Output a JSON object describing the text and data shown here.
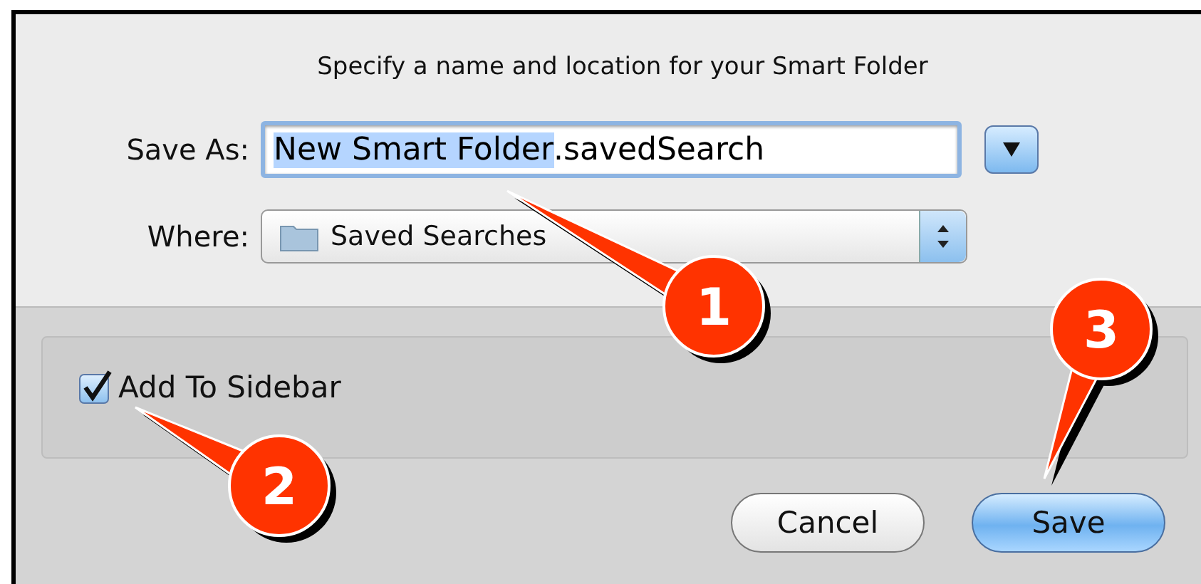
{
  "dialog": {
    "title": "Specify a name and location for your Smart Folder",
    "save_as": {
      "label": "Save As:",
      "value_selected": "New Smart Folder",
      "value_rest": ".savedSearch"
    },
    "disclosure": {
      "expanded": false
    },
    "where": {
      "label": "Where:",
      "value": "Saved Searches"
    },
    "options": [
      {
        "kind": "checkbox",
        "label": "Add To Sidebar",
        "checked": true
      }
    ],
    "buttons": [
      {
        "label": "Cancel",
        "default": false
      },
      {
        "label": "Save",
        "default": true
      }
    ]
  },
  "callouts": [
    {
      "number": "1"
    },
    {
      "number": "2"
    },
    {
      "number": "3"
    }
  ]
}
